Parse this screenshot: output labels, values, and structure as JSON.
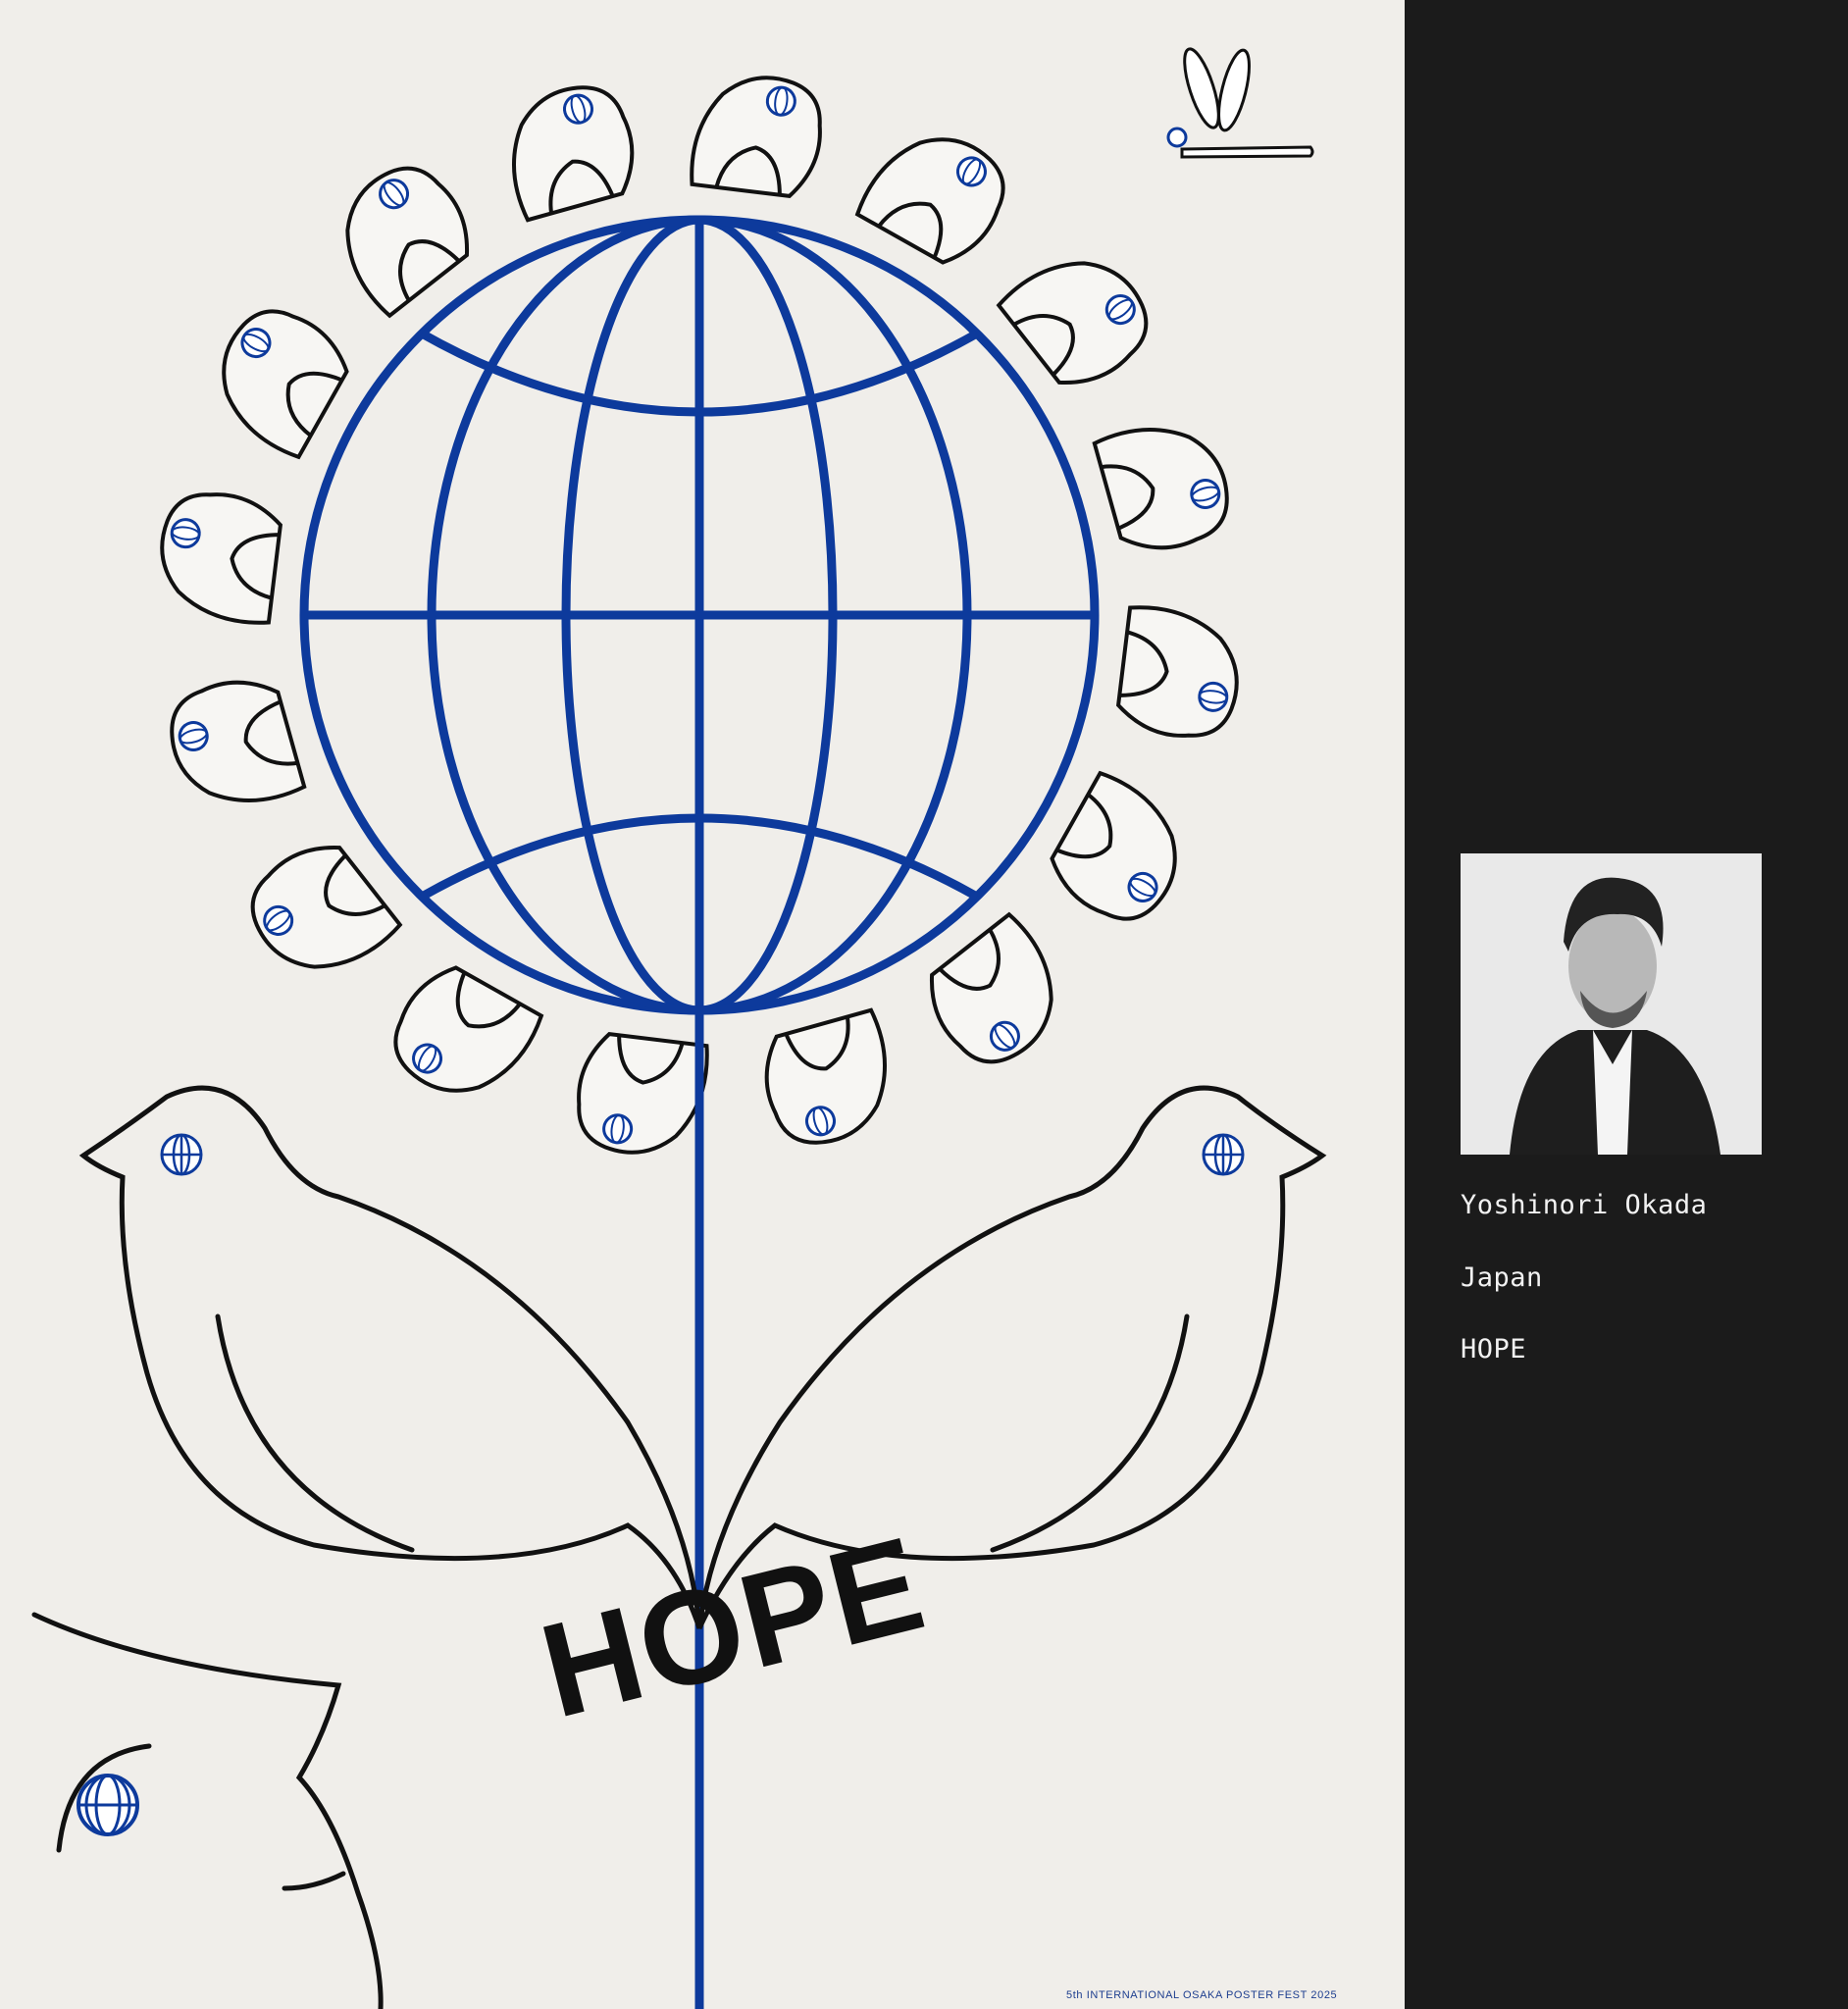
{
  "poster": {
    "title": "HOPE",
    "footer": "5th INTERNATIONAL OSAKA POSTER FEST 2025"
  },
  "sidebar": {
    "artist_name": "Yoshinori Okada",
    "country": "Japan",
    "work_title": "HOPE"
  },
  "colors": {
    "globe_blue": "#0d3a9c",
    "line_black": "#111111",
    "paper": "#f0eeea",
    "panel": "#1b1b1b"
  }
}
